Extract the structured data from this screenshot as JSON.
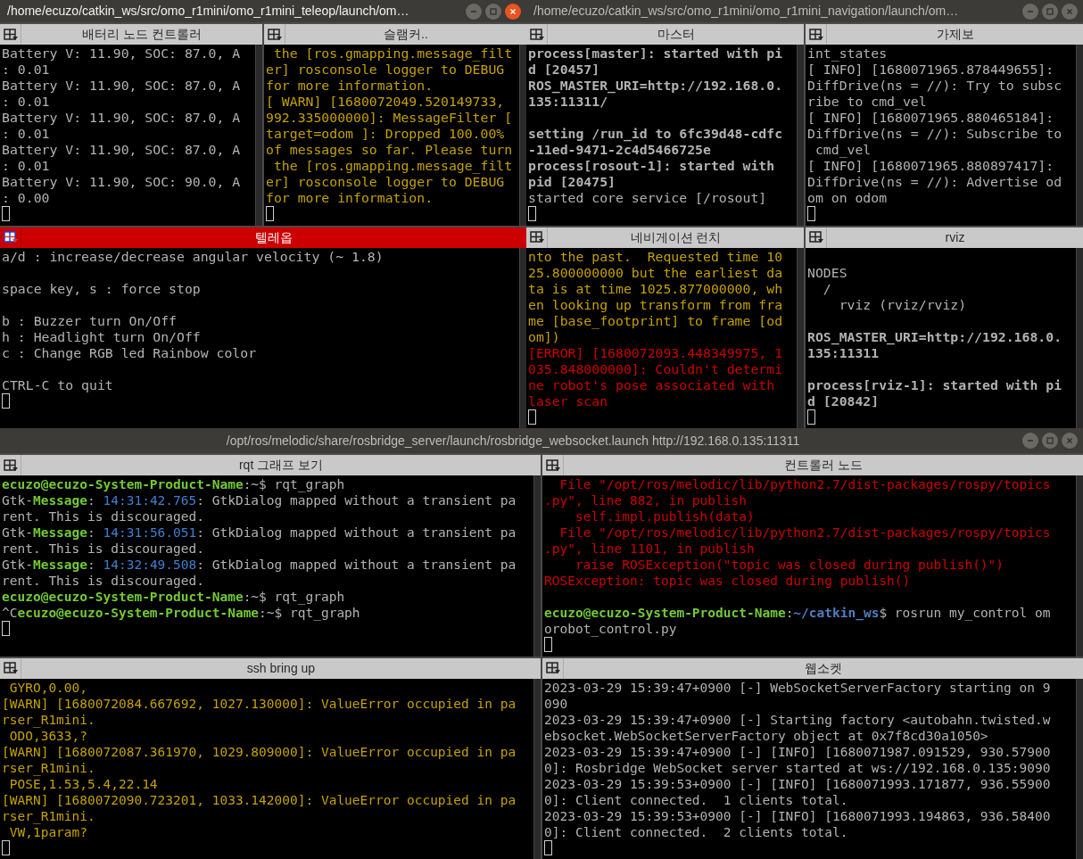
{
  "windows": [
    {
      "title": "/home/ecuzo/catkin_ws/src/omo_r1mini/omo_r1mini_teleop/launch/om…",
      "active": true,
      "rows": [
        [
          {
            "title": "배터리 노드 컨트롤러",
            "selected": false,
            "lines": [
              {
                "text": "Battery V: 11.90, SOC: 87.0, A",
                "kind": "plain"
              },
              {
                "text": ": 0.01",
                "kind": "plain"
              },
              {
                "text": "Battery V: 11.90, SOC: 87.0, A",
                "kind": "plain"
              },
              {
                "text": ": 0.01",
                "kind": "plain"
              },
              {
                "text": "Battery V: 11.90, SOC: 87.0, A",
                "kind": "plain"
              },
              {
                "text": ": 0.01",
                "kind": "plain"
              },
              {
                "text": "Battery V: 11.90, SOC: 87.0, A",
                "kind": "plain"
              },
              {
                "text": ": 0.01",
                "kind": "plain"
              },
              {
                "text": "Battery V: 11.90, SOC: 90.0, A",
                "kind": "plain"
              },
              {
                "text": ": 0.00",
                "kind": "plain"
              }
            ]
          },
          {
            "title": "슬램커..",
            "selected": false,
            "lines": [
              {
                "text": " the [ros.gmapping.message_filt",
                "kind": "warn"
              },
              {
                "text": "er] rosconsole logger to DEBUG",
                "kind": "warn"
              },
              {
                "text": "for more information.",
                "kind": "warn"
              },
              {
                "text": "[ WARN] [1680072049.520149733,",
                "kind": "warn"
              },
              {
                "text": "992.335000000]: MessageFilter [",
                "kind": "warn"
              },
              {
                "text": "target=odom ]: Dropped 100.00%",
                "kind": "warn"
              },
              {
                "text": "of messages so far. Please turn",
                "kind": "warn"
              },
              {
                "text": " the [ros.gmapping.message_filt",
                "kind": "warn"
              },
              {
                "text": "er] rosconsole logger to DEBUG",
                "kind": "warn"
              },
              {
                "text": "for more information.",
                "kind": "warn"
              }
            ]
          }
        ],
        [
          {
            "title": "텔레옵",
            "selected": true,
            "lines": [
              {
                "text": "a/d : increase/decrease angular velocity (~ 1.8)",
                "kind": "plain"
              },
              {
                "kind": "blank"
              },
              {
                "text": "space key, s : force stop",
                "kind": "plain"
              },
              {
                "kind": "blank"
              },
              {
                "text": "b : Buzzer turn On/Off",
                "kind": "plain"
              },
              {
                "text": "h : Headlight turn On/Off",
                "kind": "plain"
              },
              {
                "text": "c : Change RGB led Rainbow color",
                "kind": "plain"
              },
              {
                "kind": "blank"
              },
              {
                "text": "CTRL-C to quit",
                "kind": "plain"
              }
            ]
          }
        ]
      ]
    },
    {
      "title": "/home/ecuzo/catkin_ws/src/omo_r1mini/omo_r1mini_navigation/launch/om…",
      "active": false,
      "rows": [
        [
          {
            "title": "마스터",
            "selected": false,
            "lines": [
              {
                "text": "process[master]: started with pi",
                "kind": "bold"
              },
              {
                "text": "d [20457]",
                "kind": "bold"
              },
              {
                "text": "ROS_MASTER_URI=http://192.168.0.",
                "kind": "bold"
              },
              {
                "text": "135:11311/",
                "kind": "bold"
              },
              {
                "kind": "blank"
              },
              {
                "text": "setting /run_id to 6fc39d48-cdfc",
                "kind": "bold"
              },
              {
                "text": "-11ed-9471-2c4d5466725e",
                "kind": "bold"
              },
              {
                "text": "process[rosout-1]: started with",
                "kind": "bold"
              },
              {
                "text": "pid [20475]",
                "kind": "bold"
              },
              {
                "text": "started core service [/rosout]",
                "kind": "plain"
              }
            ]
          },
          {
            "title": "가제보",
            "selected": false,
            "lines": [
              {
                "text": "int_states",
                "kind": "plain"
              },
              {
                "text": "[ INFO] [1680071965.878449655]:",
                "kind": "plain"
              },
              {
                "text": "DiffDrive(ns = //): Try to subsc",
                "kind": "plain"
              },
              {
                "text": "ribe to cmd_vel",
                "kind": "plain"
              },
              {
                "text": "[ INFO] [1680071965.880465184]:",
                "kind": "plain"
              },
              {
                "text": "DiffDrive(ns = //): Subscribe to",
                "kind": "plain"
              },
              {
                "text": " cmd_vel",
                "kind": "plain"
              },
              {
                "text": "[ INFO] [1680071965.880897417]:",
                "kind": "plain"
              },
              {
                "text": "DiffDrive(ns = //): Advertise od",
                "kind": "plain"
              },
              {
                "text": "om on odom",
                "kind": "plain"
              }
            ]
          }
        ],
        [
          {
            "title": "네비게이션 런치",
            "selected": false,
            "lines": [
              {
                "text": "nto the past.  Requested time 10",
                "kind": "warn"
              },
              {
                "text": "25.800000000 but the earliest da",
                "kind": "warn"
              },
              {
                "text": "ta is at time 1025.877000000, wh",
                "kind": "warn"
              },
              {
                "text": "en looking up transform from fra",
                "kind": "warn"
              },
              {
                "text": "me [base_footprint] to frame [od",
                "kind": "warn"
              },
              {
                "text": "om])",
                "kind": "warn"
              },
              {
                "text": "[ERROR] [1680072093.448349975, 1",
                "kind": "error"
              },
              {
                "text": "035.848000000]: Couldn't determi",
                "kind": "error"
              },
              {
                "text": "ne robot's pose associated with",
                "kind": "error"
              },
              {
                "text": "laser scan",
                "kind": "error"
              }
            ]
          },
          {
            "title": "rviz",
            "selected": false,
            "lines": [
              {
                "kind": "blank"
              },
              {
                "text": "NODES",
                "kind": "plain"
              },
              {
                "text": "  /",
                "kind": "plain"
              },
              {
                "text": "    rviz (rviz/rviz)",
                "kind": "plain"
              },
              {
                "kind": "blank"
              },
              {
                "text": "ROS_MASTER_URI=http://192.168.0.",
                "kind": "bold"
              },
              {
                "text": "135:11311",
                "kind": "bold"
              },
              {
                "kind": "blank"
              },
              {
                "text": "process[rviz-1]: started with pi",
                "kind": "bold"
              },
              {
                "text": "d [20842]",
                "kind": "bold"
              }
            ]
          }
        ]
      ]
    },
    {
      "title": "/opt/ros/melodic/share/rosbridge_server/launch/rosbridge_websocket.launch http://192.168.0.135:11311",
      "active": false,
      "rows": [
        [
          {
            "title": "rqt 그래프 보기",
            "selected": false,
            "lines": [
              {
                "kind": "mixed",
                "spans": [
                  {
                    "text": "ecuzo@ecuzo-System-Product-Name",
                    "kind": "prompt"
                  },
                  {
                    "text": ":~$ rqt_graph",
                    "kind": "plain"
                  }
                ]
              },
              {
                "kind": "mixed",
                "spans": [
                  {
                    "text": "Gtk-",
                    "kind": "plain"
                  },
                  {
                    "text": "Message",
                    "kind": "prompt"
                  },
                  {
                    "text": ": ",
                    "kind": "plain"
                  },
                  {
                    "text": "14:31:42.765",
                    "kind": "time"
                  },
                  {
                    "text": ": GtkDialog mapped without a transient pa",
                    "kind": "plain"
                  }
                ]
              },
              {
                "text": "rent. This is discouraged.",
                "kind": "plain"
              },
              {
                "kind": "mixed",
                "spans": [
                  {
                    "text": "Gtk-",
                    "kind": "plain"
                  },
                  {
                    "text": "Message",
                    "kind": "prompt"
                  },
                  {
                    "text": ": ",
                    "kind": "plain"
                  },
                  {
                    "text": "14:31:56.051",
                    "kind": "time"
                  },
                  {
                    "text": ": GtkDialog mapped without a transient pa",
                    "kind": "plain"
                  }
                ]
              },
              {
                "text": "rent. This is discouraged.",
                "kind": "plain"
              },
              {
                "kind": "mixed",
                "spans": [
                  {
                    "text": "Gtk-",
                    "kind": "plain"
                  },
                  {
                    "text": "Message",
                    "kind": "prompt"
                  },
                  {
                    "text": ": ",
                    "kind": "plain"
                  },
                  {
                    "text": "14:32:49.508",
                    "kind": "time"
                  },
                  {
                    "text": ": GtkDialog mapped without a transient pa",
                    "kind": "plain"
                  }
                ]
              },
              {
                "text": "rent. This is discouraged.",
                "kind": "plain"
              },
              {
                "kind": "mixed",
                "spans": [
                  {
                    "text": "ecuzo@ecuzo-System-Product-Name",
                    "kind": "prompt"
                  },
                  {
                    "text": ":~$ rqt_graph",
                    "kind": "plain"
                  }
                ]
              },
              {
                "kind": "mixed",
                "spans": [
                  {
                    "text": "^C",
                    "kind": "plain"
                  },
                  {
                    "text": "ecuzo@ecuzo-System-Product-Name",
                    "kind": "prompt"
                  },
                  {
                    "text": ":~$ rqt_graph",
                    "kind": "plain"
                  }
                ]
              }
            ]
          },
          {
            "title": "컨트롤러 노드",
            "selected": false,
            "lines": [
              {
                "text": "  File \"/opt/ros/melodic/lib/python2.7/dist-packages/rospy/topics",
                "kind": "error"
              },
              {
                "text": ".py\", line 882, in publish",
                "kind": "error"
              },
              {
                "text": "    self.impl.publish(data)",
                "kind": "error"
              },
              {
                "text": "  File \"/opt/ros/melodic/lib/python2.7/dist-packages/rospy/topics",
                "kind": "error"
              },
              {
                "text": ".py\", line 1101, in publish",
                "kind": "error"
              },
              {
                "text": "    raise ROSException(\"topic was closed during publish()\")",
                "kind": "error"
              },
              {
                "text": "ROSException: topic was closed during publish()",
                "kind": "error"
              },
              {
                "kind": "blank"
              },
              {
                "kind": "mixed",
                "spans": [
                  {
                    "text": "ecuzo@ecuzo-System-Product-Name",
                    "kind": "prompt"
                  },
                  {
                    "text": ":",
                    "kind": "plain"
                  },
                  {
                    "text": "~/catkin_ws",
                    "kind": "path"
                  },
                  {
                    "text": "$ rosrun my_control om",
                    "kind": "plain"
                  }
                ]
              },
              {
                "text": "orobot_control.py",
                "kind": "plain"
              }
            ]
          }
        ],
        [
          {
            "title": "ssh bring up",
            "selected": false,
            "lines": [
              {
                "text": " GYRO,0.00,",
                "kind": "warn"
              },
              {
                "text": "[WARN] [1680072084.667692, 1027.130000]: ValueError occupied in pa",
                "kind": "warn"
              },
              {
                "text": "rser_R1mini.",
                "kind": "warn"
              },
              {
                "text": " ODO,3633,?",
                "kind": "warn"
              },
              {
                "text": "[WARN] [1680072087.361970, 1029.809000]: ValueError occupied in pa",
                "kind": "warn"
              },
              {
                "text": "rser_R1mini.",
                "kind": "warn"
              },
              {
                "text": " POSE,1.53,5.4,22.14",
                "kind": "warn"
              },
              {
                "text": "[WARN] [1680072090.723201, 1033.142000]: ValueError occupied in pa",
                "kind": "warn"
              },
              {
                "text": "rser_R1mini.",
                "kind": "warn"
              },
              {
                "text": " VW,1param?",
                "kind": "warn"
              }
            ]
          },
          {
            "title": "웹소켓",
            "selected": false,
            "lines": [
              {
                "text": "2023-03-29 15:39:47+0900 [-] WebSocketServerFactory starting on 9",
                "kind": "plain"
              },
              {
                "text": "090",
                "kind": "plain"
              },
              {
                "text": "2023-03-29 15:39:47+0900 [-] Starting factory <autobahn.twisted.w",
                "kind": "plain"
              },
              {
                "text": "ebsocket.WebSocketServerFactory object at 0x7f8cd30a1050>",
                "kind": "plain"
              },
              {
                "text": "2023-03-29 15:39:47+0900 [-] [INFO] [1680071987.091529, 930.57900",
                "kind": "plain"
              },
              {
                "text": "0]: Rosbridge WebSocket server started at ws://192.168.0.135:9090",
                "kind": "plain"
              },
              {
                "text": "2023-03-29 15:39:53+0900 [-] [INFO] [1680071993.171877, 936.55900",
                "kind": "plain"
              },
              {
                "text": "0]: Client connected.  1 clients total.",
                "kind": "plain"
              },
              {
                "text": "2023-03-29 15:39:53+0900 [-] [INFO] [1680071993.194863, 936.58400",
                "kind": "plain"
              },
              {
                "text": "0]: Client connected.  2 clients total.",
                "kind": "plain"
              }
            ]
          }
        ]
      ]
    }
  ]
}
